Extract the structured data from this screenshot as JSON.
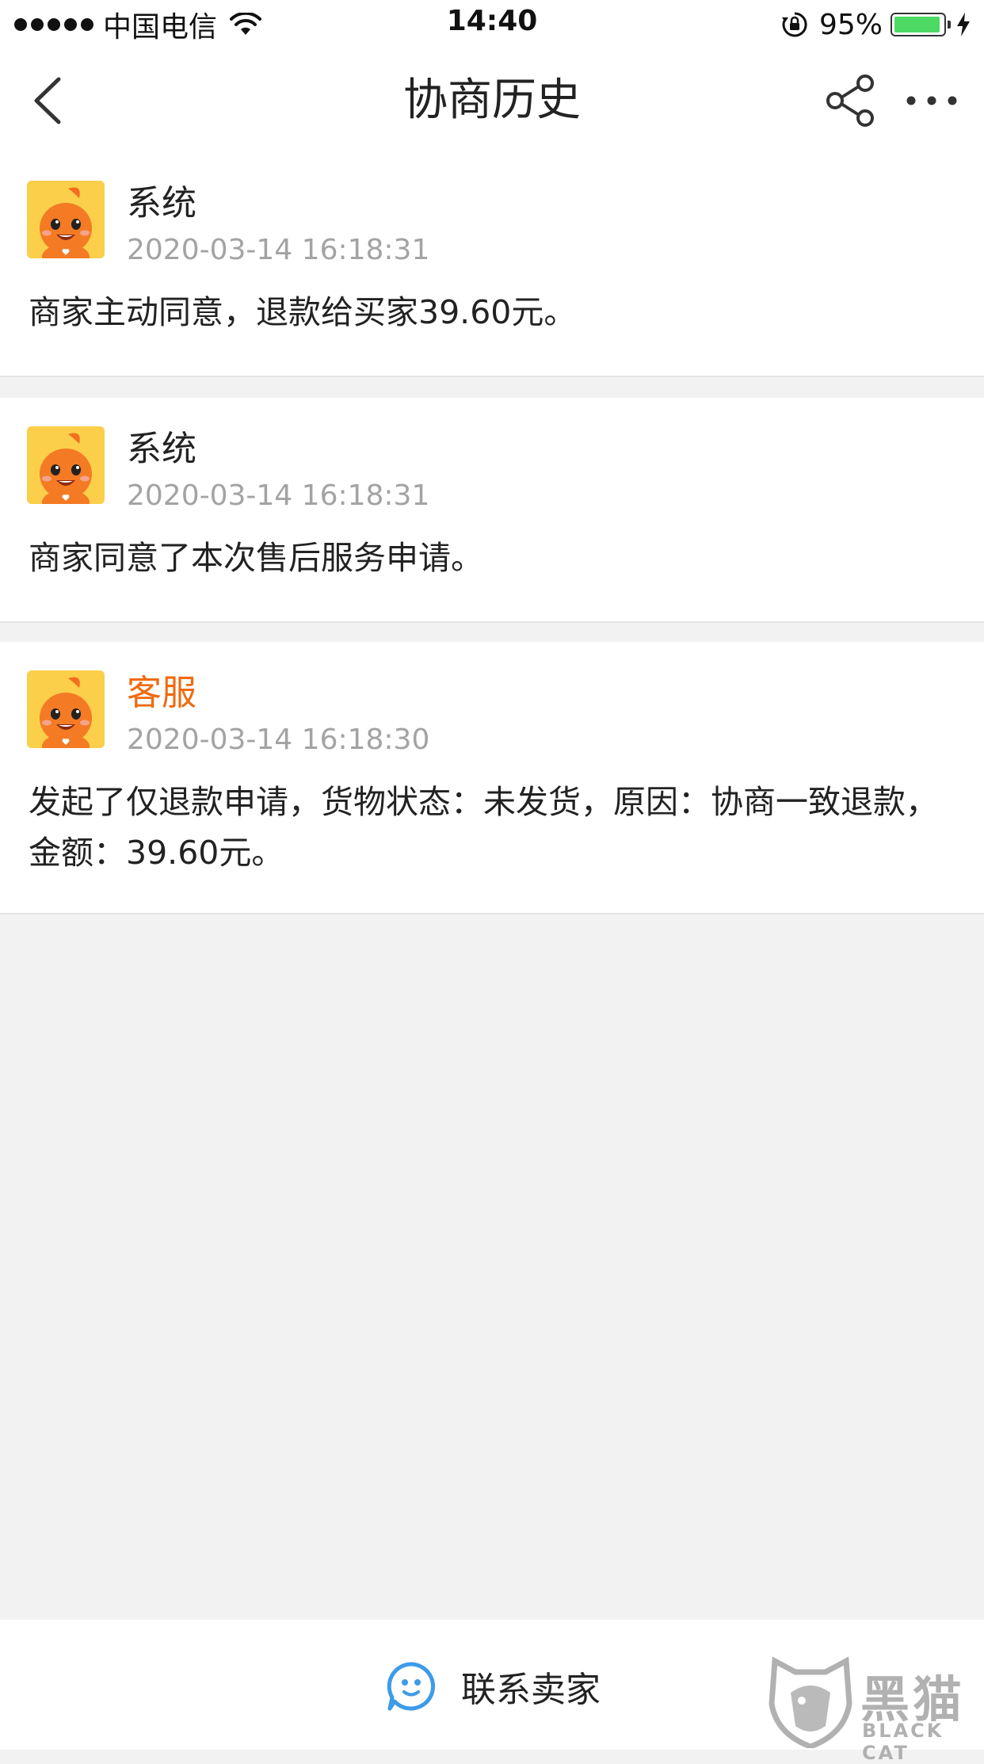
{
  "status_bar": {
    "carrier": "中国电信",
    "time": "14:40",
    "battery_percent": "95%",
    "battery_level": 0.95,
    "battery_color": "#4cd964"
  },
  "nav": {
    "title": "协商历史",
    "back_icon": "chevron-left-icon",
    "share_icon": "share-icon",
    "more_icon": "more-icon"
  },
  "messages": [
    {
      "sender": "系统",
      "time": "2020-03-14 16:18:31",
      "text": "商家主动同意，退款给买家39.60元。"
    },
    {
      "sender": "系统",
      "time": "2020-03-14 16:18:31",
      "text": "商家同意了本次售后服务申请。"
    },
    {
      "sender": "客服",
      "time": "2020-03-14 16:18:30",
      "text": "发起了仅退款申请，货物状态：未发货，原因：协商一致退款，金额：39.60元。"
    }
  ],
  "bottom": {
    "contact_label": "联系卖家",
    "contact_icon": "chat-bubble-icon"
  },
  "watermark": {
    "brand": "黑猫",
    "sub": "BLACK CAT"
  },
  "colors": {
    "accent": "#f06a0f",
    "background": "#f2f2f3",
    "timestamp": "#a3a3a3",
    "link_blue": "#3d9be9"
  }
}
